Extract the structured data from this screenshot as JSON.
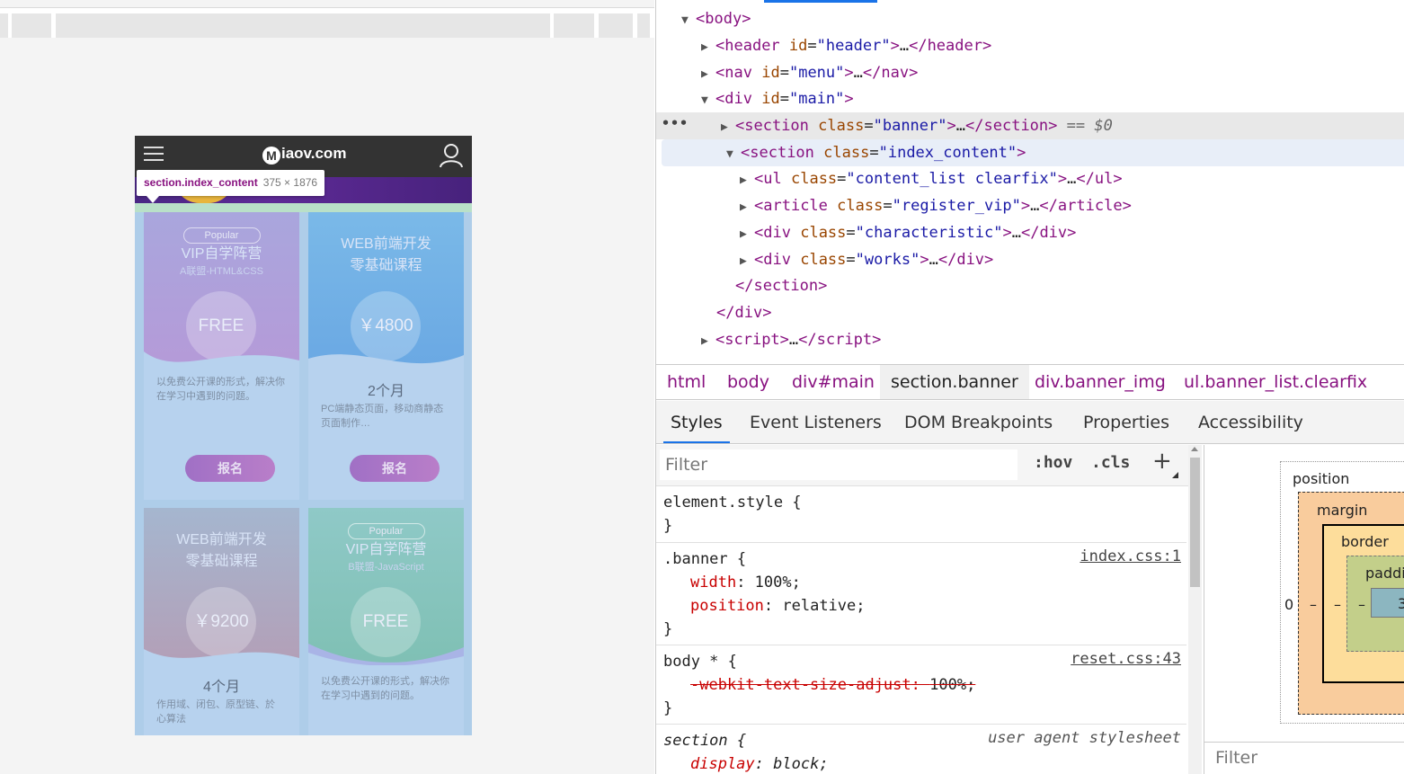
{
  "preview": {
    "logo": "iaov.com",
    "logo_mark": "M",
    "tooltip_selector": "section.index_content",
    "tooltip_size": "375 × 1876",
    "cards": [
      {
        "badge": "Popular",
        "title": "VIP自学阵营",
        "subtitle": "A联盟-HTML&CSS",
        "price": "FREE",
        "months": "",
        "desc": "以免费公开课的形式，解决你在学习中遇到的问题。",
        "button": "报名"
      },
      {
        "badge": "",
        "title": "WEB前端开发",
        "subtitle": "零基础课程",
        "price": "￥4800",
        "months": "2个月",
        "desc": "PC端静态页面，移动商静态页面制作…",
        "button": "报名"
      },
      {
        "badge": "",
        "title": "WEB前端开发",
        "subtitle": "零基础课程",
        "price": "￥9200",
        "months": "4个月",
        "desc": "作用域、闭包、原型链、於 心算法",
        "button": ""
      },
      {
        "badge": "Popular",
        "title": "VIP自学阵营",
        "subtitle": "B联盟-JavaScript",
        "price": "FREE",
        "months": "",
        "desc": "以免费公开课的形式，解决你在学习中遇到的问题。",
        "button": ""
      }
    ]
  },
  "dom": {
    "line1": {
      "tag": "body"
    },
    "line2": {
      "tag": "header",
      "attr": "id",
      "val": "header"
    },
    "line3": {
      "tag": "nav",
      "attr": "id",
      "val": "menu"
    },
    "line4": {
      "tag": "div",
      "attr": "id",
      "val": "main"
    },
    "line5": {
      "tag": "section",
      "attr": "class",
      "val": "banner",
      "suffix": "== $0"
    },
    "line6": {
      "tag": "section",
      "attr": "class",
      "val": "index_content"
    },
    "line7": {
      "tag": "ul",
      "attr": "class",
      "val": "content_list clearfix",
      "close": "ul"
    },
    "line8": {
      "tag": "article",
      "attr": "class",
      "val": "register_vip",
      "close": "article"
    },
    "line9": {
      "tag": "div",
      "attr": "class",
      "val": "characteristic",
      "close": "div"
    },
    "line10": {
      "tag": "div",
      "attr": "class",
      "val": "works",
      "close": "div"
    },
    "line11": {
      "close": "section"
    },
    "line12": {
      "close": "div"
    },
    "line13": {
      "tag": "script"
    },
    "ellipsis": "•••"
  },
  "breadcrumbs": [
    "html",
    "body",
    "div#main",
    "section.banner",
    "div.banner_img",
    "ul.banner_list.clearfix"
  ],
  "tabs": [
    "Styles",
    "Event Listeners",
    "DOM Breakpoints",
    "Properties",
    "Accessibility"
  ],
  "styles": {
    "filter_placeholder": "Filter",
    "hov": ":hov",
    "cls": ".cls",
    "plus": "+",
    "rules": {
      "element": {
        "selector": "element.style {",
        "close": "}"
      },
      "banner": {
        "selector": ".banner {",
        "source": "index.css:1",
        "p1_name": "width",
        "p1_value": "100%;",
        "p2_name": "position",
        "p2_value": "relative;",
        "close": "}"
      },
      "body_star": {
        "selector": "body * {",
        "source": "reset.css:43",
        "p1_name": "-webkit-text-size-adjust",
        "p1_value": "100%;",
        "close": "}"
      },
      "section": {
        "selector": "section {",
        "source": "user agent stylesheet",
        "p1_name": "display",
        "p1_value": "block;"
      }
    }
  },
  "box_model": {
    "position": "position",
    "margin": "margin",
    "border": "border",
    "padding": "paddi",
    "left_value": "0",
    "dash": "–",
    "content_value": "3",
    "filter": "Filter"
  }
}
